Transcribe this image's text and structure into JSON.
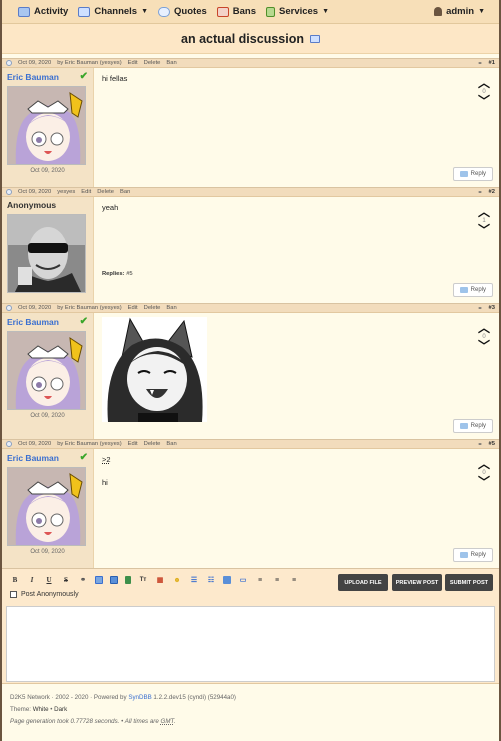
{
  "nav": {
    "items": [
      {
        "label": "Activity",
        "icon": "activity-icon",
        "caret": false
      },
      {
        "label": "Channels",
        "icon": "channels-icon",
        "caret": true
      },
      {
        "label": "Quotes",
        "icon": "quotes-icon",
        "caret": false
      },
      {
        "label": "Bans",
        "icon": "bans-icon",
        "caret": false
      },
      {
        "label": "Services",
        "icon": "services-icon",
        "caret": true
      }
    ],
    "user": "admin"
  },
  "page_title": "an actual discussion",
  "posts": [
    {
      "header": {
        "date": "Oct 09, 2020",
        "by": "by Eric Bauman (yesyes)",
        "edit": "Edit",
        "delete": "Delete",
        "ban": "Ban",
        "number": "#1"
      },
      "author": "Eric Bauman",
      "verified": true,
      "avatar_date": "Oct 09, 2020",
      "body": "hi fellas",
      "votes": "0",
      "reply": "Reply"
    },
    {
      "header": {
        "date": "Oct 09, 2020",
        "by": "yesyes",
        "edit": "Edit",
        "delete": "Delete",
        "ban": "Ban",
        "number": "#2"
      },
      "author": "Anonymous",
      "verified": false,
      "avatar_date": "",
      "body": "yeah",
      "votes": "1",
      "replies_label": "Replies:",
      "replies_value": "#5",
      "reply": "Reply"
    },
    {
      "header": {
        "date": "Oct 09, 2020",
        "by": "by Eric Bauman (yesyes)",
        "edit": "Edit",
        "delete": "Delete",
        "ban": "Ban",
        "number": "#3"
      },
      "author": "Eric Bauman",
      "verified": true,
      "avatar_date": "Oct 09, 2020",
      "body": "",
      "votes": "0",
      "reply": "Reply"
    },
    {
      "header": {
        "date": "Oct 09, 2020",
        "by": "by Eric Bauman (yesyes)",
        "edit": "Edit",
        "delete": "Delete",
        "ban": "Ban",
        "number": "#5"
      },
      "author": "Eric Bauman",
      "verified": true,
      "avatar_date": "Oct 09, 2020",
      "quote": ">2",
      "body": "hi",
      "votes": "0",
      "reply": "Reply"
    }
  ],
  "editor": {
    "upload": "UPLOAD FILE",
    "preview": "PREVIEW POST",
    "submit": "SUBMIT POST",
    "post_anon": "Post Anonymously"
  },
  "footer": {
    "line1_a": "D2K5 Network · 2002 - 2020 · Powered by ",
    "line1_link": "SynDBB",
    "line1_b": " 1.2.2.dev15 (cyndi) (52944a0)",
    "theme_label": "Theme: ",
    "theme_white": "White",
    "theme_sep": " • ",
    "theme_dark": "Dark",
    "gen_a": "Page generation took 0.77728 seconds. • All times are ",
    "gen_gmt": "GMT",
    "gen_b": "."
  },
  "colors": {
    "nav_bg": "#f7dfb8",
    "title_bg": "#fde7c6",
    "author_bg": "#f4e3c6",
    "post_bg": "#fffbe9",
    "link": "#3a6fd0",
    "verified": "#39a52a",
    "button_dark": "#434343"
  }
}
